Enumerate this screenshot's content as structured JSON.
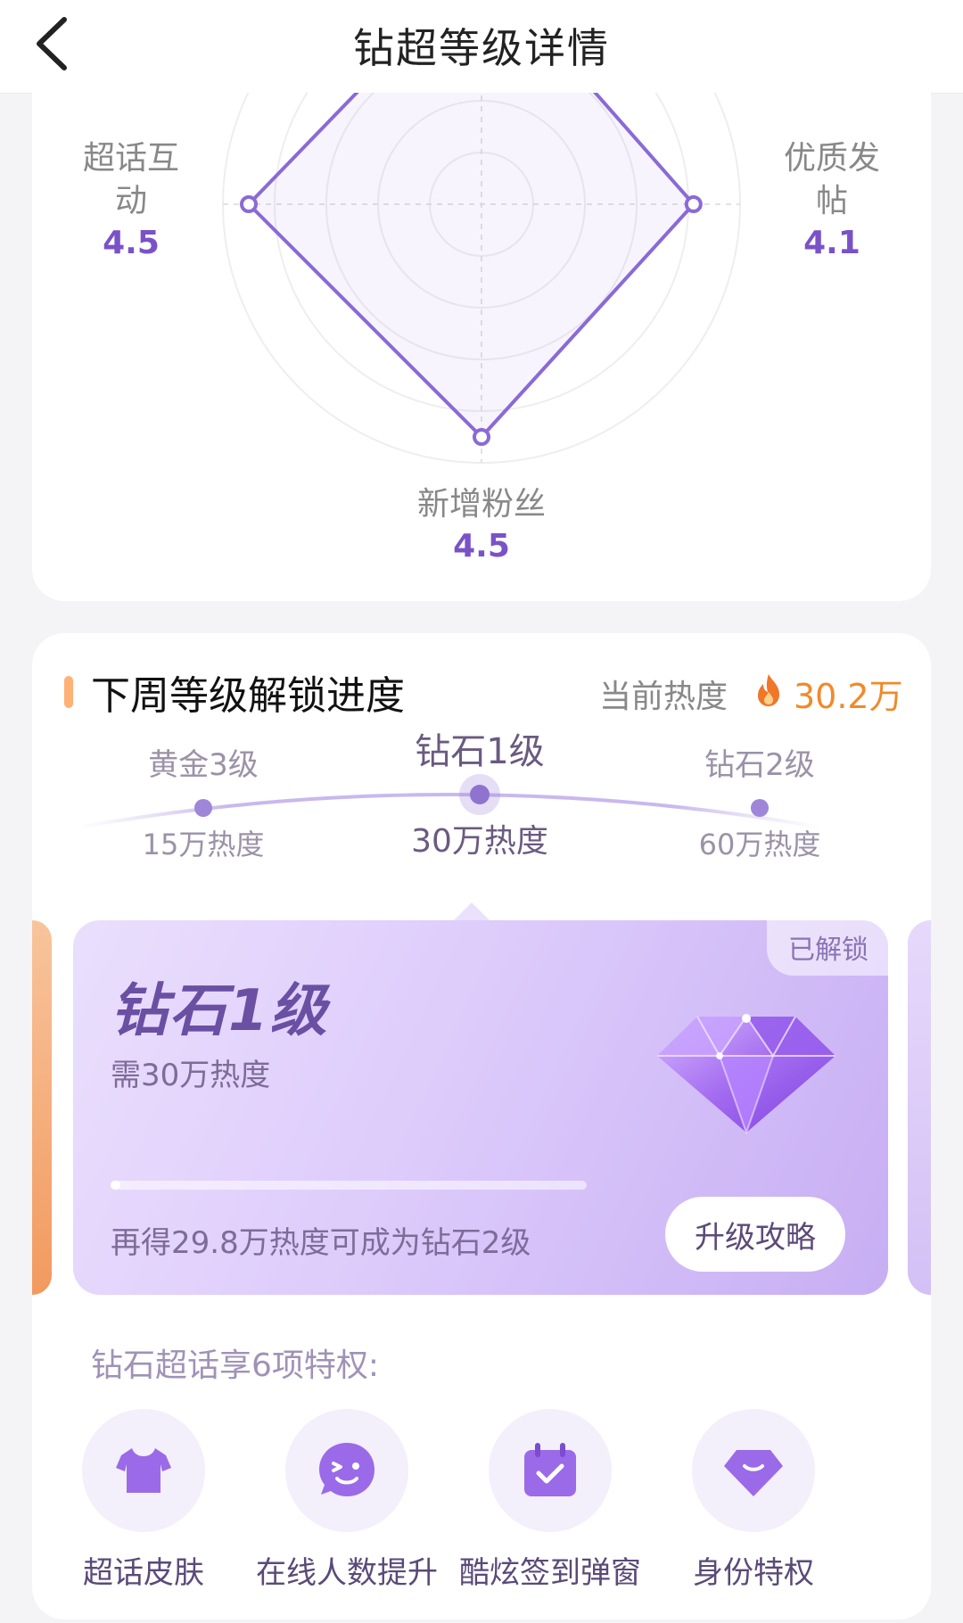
{
  "header": {
    "title": "钻超等级详情",
    "back_icon": "chevron-left-icon"
  },
  "radar": {
    "axes": [
      {
        "name": "优质发帖",
        "value": "4.1",
        "score": 4.1
      },
      {
        "name": "新增粉丝",
        "value": "4.5",
        "score": 4.5
      },
      {
        "name": "超话互动",
        "value": "4.5",
        "score": 4.5
      }
    ],
    "label_left_line1": "超话互",
    "label_left_line2": "动",
    "label_right_line1": "优质发",
    "label_right_line2": "帖",
    "color": "#8a6ad6"
  },
  "progress_section": {
    "title": "下周等级解锁进度",
    "heat_label": "当前热度",
    "heat_value": "30.2万",
    "accent_color": "#f08a2a"
  },
  "levels": [
    {
      "name": "黄金3级",
      "heat": "15万热度"
    },
    {
      "name": "钻石1级",
      "heat": "30万热度",
      "current": true
    },
    {
      "name": "钻石2级",
      "heat": "60万热度"
    }
  ],
  "level_card": {
    "badge": "已解锁",
    "level_name": "钻石1级",
    "requirement": "需30万热度",
    "progress_fraction": 0.0,
    "progress_text": "再得29.8万热度可成为钻石2级",
    "button_label": "升级攻略",
    "gem_icon": "diamond-gem-icon"
  },
  "privileges": {
    "title": "钻石超话享6项特权:",
    "items": [
      {
        "label": "超话皮肤",
        "icon": "tshirt-icon"
      },
      {
        "label": "在线人数提升",
        "icon": "wink-face-icon"
      },
      {
        "label": "酷炫签到弹窗",
        "icon": "calendar-check-icon"
      },
      {
        "label": "身份特权",
        "icon": "diamond-icon"
      }
    ]
  }
}
